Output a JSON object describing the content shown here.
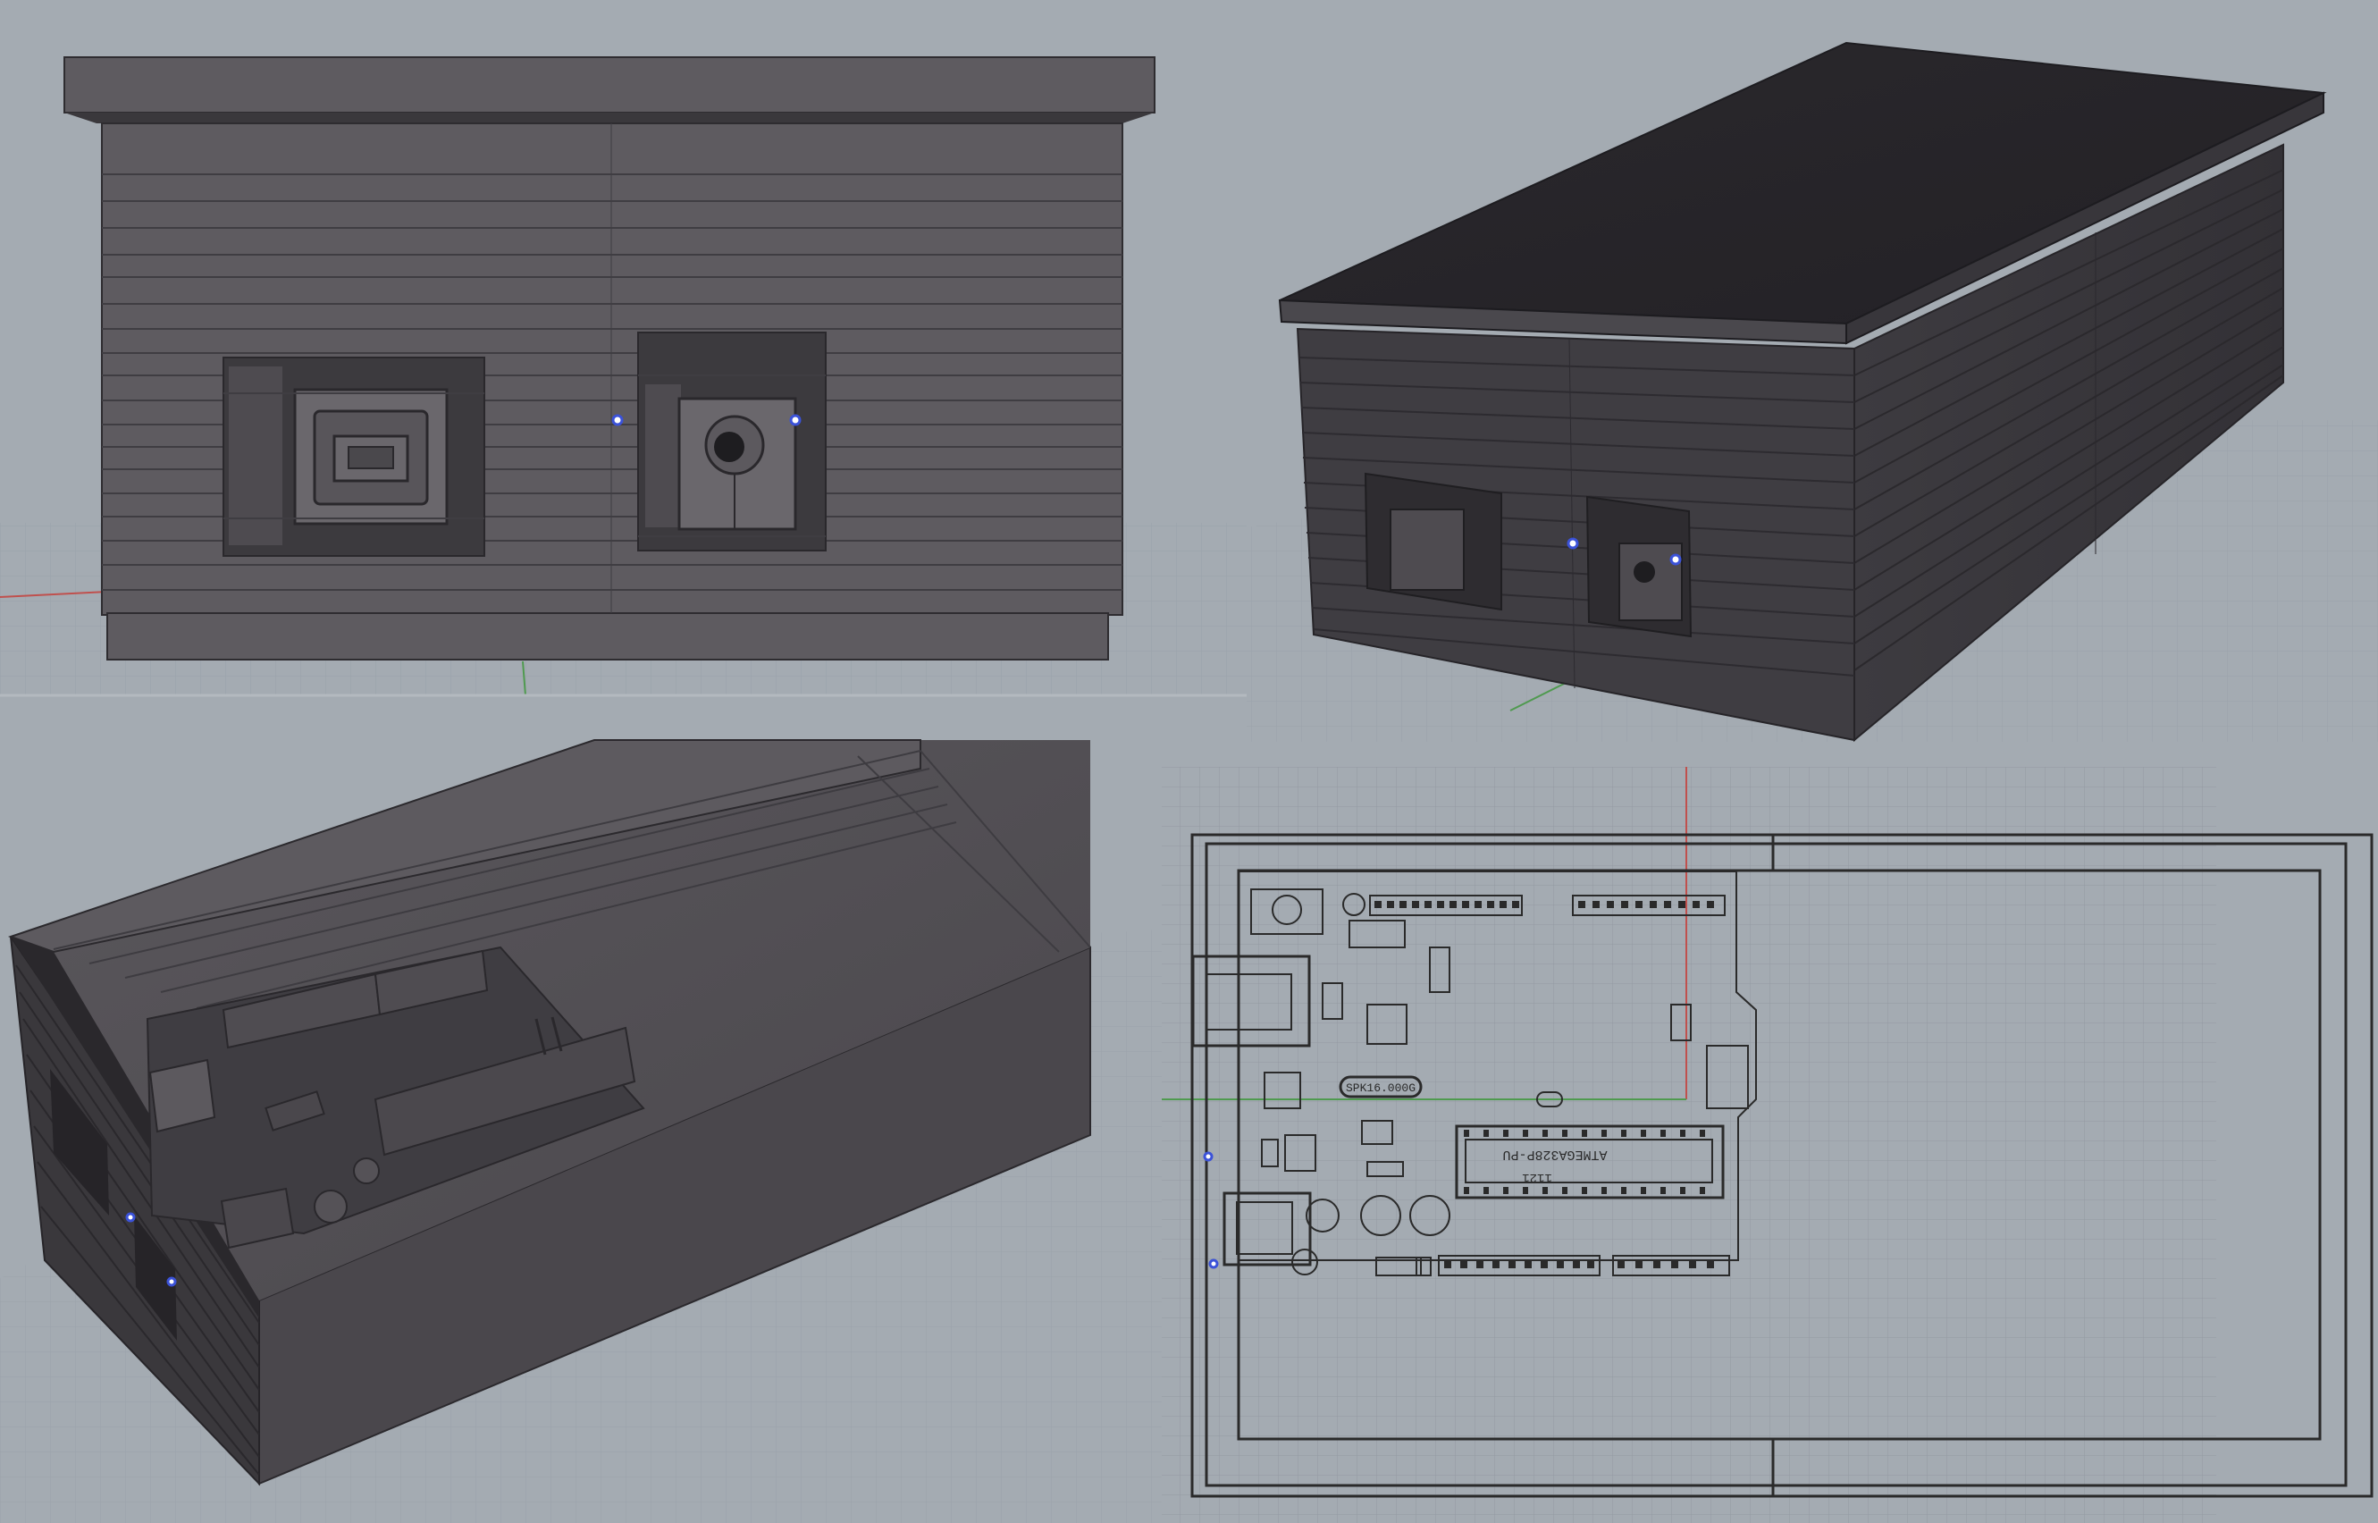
{
  "viewports": [
    {
      "view": "front",
      "display_mode": "shaded"
    },
    {
      "view": "perspective-top",
      "display_mode": "shaded"
    },
    {
      "view": "perspective-open-case",
      "display_mode": "shaded"
    },
    {
      "view": "top",
      "display_mode": "wireframe"
    }
  ],
  "pcb": {
    "chip_label": "ATMEGA328P-PU",
    "chip_sublabel": "1121",
    "crystal_label": "SPK16.000G"
  },
  "colors": {
    "viewport_bg": "#a4abb2",
    "grid_line": "#98a0a8",
    "case_fill": "#5e5b60",
    "case_dark": "#2b292d",
    "stripe": "#47454a",
    "axis_red": "#c0504d",
    "axis_green": "#4f9a4f",
    "control_point": "#3b52d8"
  },
  "icons": [
    "usb-b-port-icon",
    "dc-barrel-jack-icon",
    "control-point-icon"
  ]
}
